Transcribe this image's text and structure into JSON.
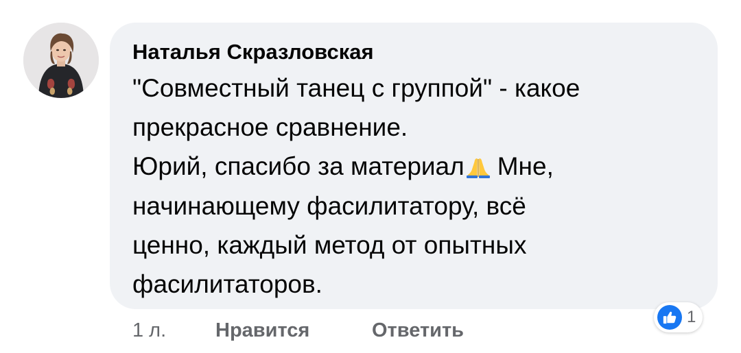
{
  "comment": {
    "author": "Наталья Скразловская",
    "text_lines": [
      "\"Совместный танец с группой\" - какое",
      "прекрасное сравнение.",
      "Юрий, спасибо за материал",
      "Мне,",
      "начинающему фасилитатору, всё",
      "ценно, каждый метод от опытных",
      "фасилитаторов."
    ],
    "emoji": "folded-hands"
  },
  "actions": {
    "time": "1 л.",
    "like_label": "Нравится",
    "reply_label": "Ответить"
  },
  "reactions": {
    "icon": "thumbs-up-icon",
    "count": "1"
  },
  "colors": {
    "bubble": "#f0f2f5",
    "text": "#050505",
    "meta": "#65676b",
    "like_blue": "#1877f2"
  }
}
